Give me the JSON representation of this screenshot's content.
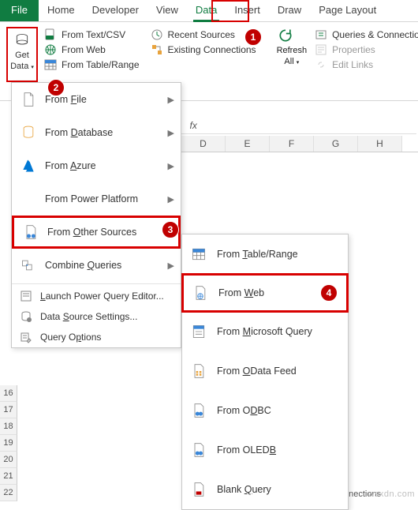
{
  "tabs": {
    "file": "File",
    "home": "Home",
    "developer": "Developer",
    "view": "View",
    "data": "Data",
    "insert": "Insert",
    "draw": "Draw",
    "pagelayout": "Page Layout"
  },
  "ribbon": {
    "getdata": {
      "line1": "Get",
      "line2": "Data"
    },
    "col1": {
      "textcsv": "From Text/CSV",
      "web": "From Web",
      "tablerange": "From Table/Range"
    },
    "col2": {
      "recent": "Recent Sources",
      "existing": "Existing Connections"
    },
    "refresh": {
      "line1": "Refresh",
      "line2": "All"
    },
    "col3": {
      "queries": "Queries & Connections",
      "properties": "Properties",
      "editlinks": "Edit Links"
    },
    "group_label": "Queries & Connections"
  },
  "menu1": {
    "from_file": "From File",
    "from_database": "From Database",
    "from_azure": "From Azure",
    "from_powerplatform": "From Power Platform",
    "from_other": "From Other Sources",
    "combine": "Combine Queries",
    "launch_pq": "Launch Power Query Editor...",
    "data_source": "Data Source Settings...",
    "query_options": "Query Options"
  },
  "menu2": {
    "table_range": "From Table/Range",
    "web": "From Web",
    "ms_query": "From Microsoft Query",
    "odata": "From OData Feed",
    "odbc": "From ODBC",
    "oledb": "From OLEDB",
    "blank": "Blank Query"
  },
  "columns": [
    "D",
    "E",
    "F",
    "G",
    "H"
  ],
  "rows": [
    "16",
    "17",
    "18",
    "19",
    "20",
    "21",
    "22"
  ],
  "callouts": {
    "c1": "1",
    "c2": "2",
    "c3": "3",
    "c4": "4"
  },
  "watermark": "wsxdn.com",
  "formula_bar": {
    "fx": "fx"
  }
}
